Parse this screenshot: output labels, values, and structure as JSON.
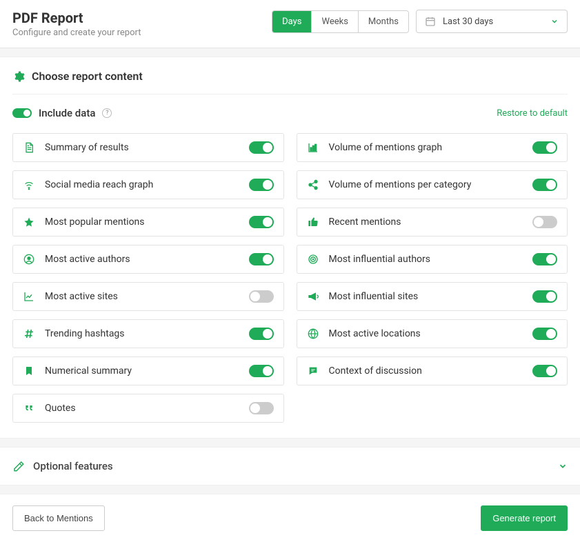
{
  "header": {
    "title": "PDF Report",
    "subtitle": "Configure and create your report"
  },
  "timeframe": {
    "options": [
      "Days",
      "Weeks",
      "Months"
    ],
    "active": "Days",
    "range_label": "Last 30 days"
  },
  "section_title": "Choose report content",
  "include": {
    "label": "Include data",
    "help": "?",
    "on": true,
    "restore": "Restore to default"
  },
  "left_items": [
    {
      "icon": "file-text-icon",
      "label": "Summary of results",
      "on": true
    },
    {
      "icon": "wifi-icon",
      "label": "Social media reach graph",
      "on": true
    },
    {
      "icon": "star-icon",
      "label": "Most popular mentions",
      "on": true
    },
    {
      "icon": "user-circle-icon",
      "label": "Most active authors",
      "on": true
    },
    {
      "icon": "chart-line-icon",
      "label": "Most active sites",
      "on": false
    },
    {
      "icon": "hashtag-icon",
      "label": "Trending hashtags",
      "on": true
    },
    {
      "icon": "bookmark-icon",
      "label": "Numerical summary",
      "on": true
    },
    {
      "icon": "quote-icon",
      "label": "Quotes",
      "on": false
    }
  ],
  "right_items": [
    {
      "icon": "chart-bar-icon",
      "label": "Volume of mentions graph",
      "on": true
    },
    {
      "icon": "share-icon",
      "label": "Volume of mentions per category",
      "on": true
    },
    {
      "icon": "thumbs-up-icon",
      "label": "Recent mentions",
      "on": false
    },
    {
      "icon": "target-icon",
      "label": "Most influential authors",
      "on": true
    },
    {
      "icon": "bullhorn-icon",
      "label": "Most influential sites",
      "on": true
    },
    {
      "icon": "globe-icon",
      "label": "Most active locations",
      "on": true
    },
    {
      "icon": "chat-icon",
      "label": "Context of discussion",
      "on": true
    }
  ],
  "optional_title": "Optional features",
  "footer": {
    "back": "Back to Mentions",
    "generate": "Generate report"
  }
}
